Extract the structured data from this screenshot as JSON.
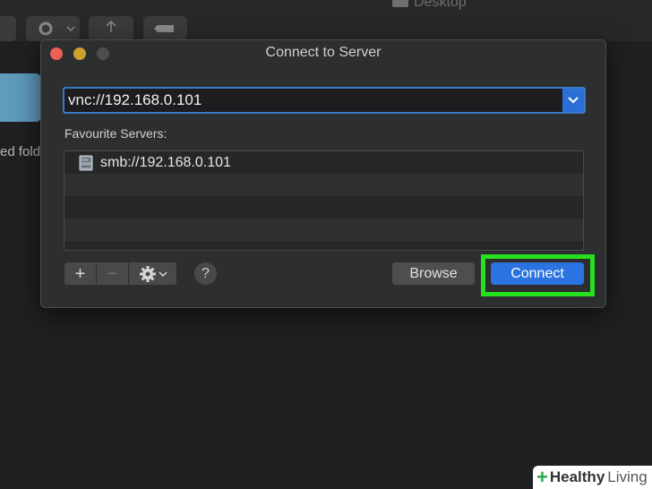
{
  "background": {
    "window_title": "Desktop",
    "folder_label": "ed fold"
  },
  "dialog": {
    "title": "Connect to Server",
    "address_value": "vnc://192.168.0.101",
    "favourites_label": "Favourite Servers:",
    "favourites": [
      {
        "label": "smb://192.168.0.101",
        "icon": "server-icon"
      }
    ],
    "add_label": "+",
    "remove_label": "−",
    "help_label": "?",
    "browse_label": "Browse",
    "connect_label": "Connect",
    "colors": {
      "close": "#ec5f57",
      "minimize": "#c9a12d",
      "zoom": "#4d4e50",
      "accent": "#2b73e0",
      "highlight": "#26e01e"
    }
  },
  "watermark": {
    "plus": "+",
    "word1": "Healthy",
    "word2": "Living"
  }
}
